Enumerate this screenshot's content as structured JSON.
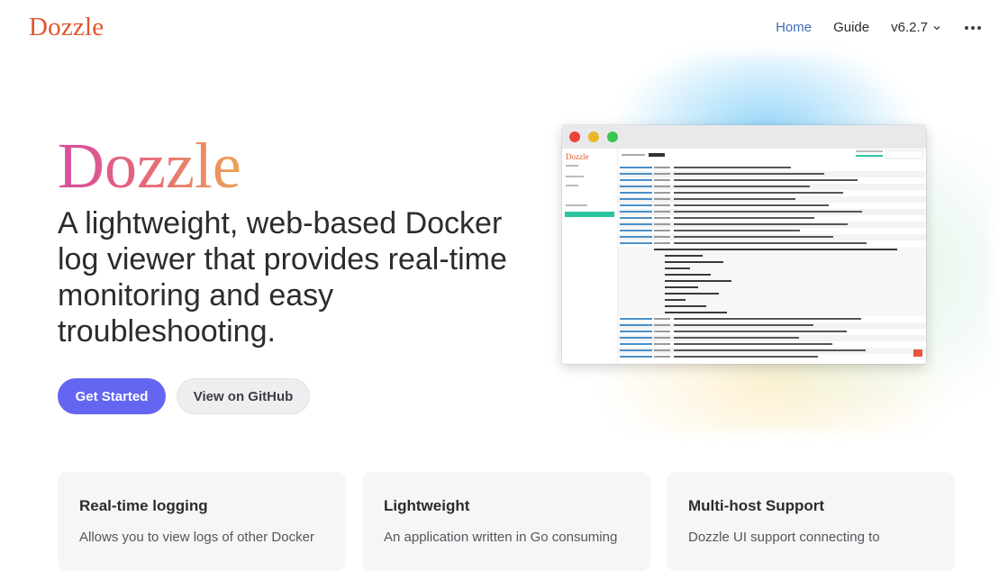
{
  "nav": {
    "logo": "Dozzle",
    "links": [
      {
        "label": "Home",
        "active": true
      },
      {
        "label": "Guide",
        "active": false
      }
    ],
    "version": "v6.2.7"
  },
  "hero": {
    "name": "Dozzle",
    "tagline": "A lightweight, web-based Docker log viewer that provides real-time monitoring and easy troubleshooting.",
    "primary_button": "Get Started",
    "secondary_button": "View on GitHub"
  },
  "preview": {
    "logo": "Dozzle"
  },
  "features": [
    {
      "title": "Real-time logging",
      "desc": "Allows you to view logs of other Docker"
    },
    {
      "title": "Lightweight",
      "desc": "An application written in Go consuming"
    },
    {
      "title": "Multi-host Support",
      "desc": "Dozzle UI support connecting to"
    }
  ],
  "colors": {
    "brand": "#e0562c",
    "primary_button": "#6466f1",
    "active_link": "#3c6fb8",
    "selected_container": "#2cc5a0"
  }
}
